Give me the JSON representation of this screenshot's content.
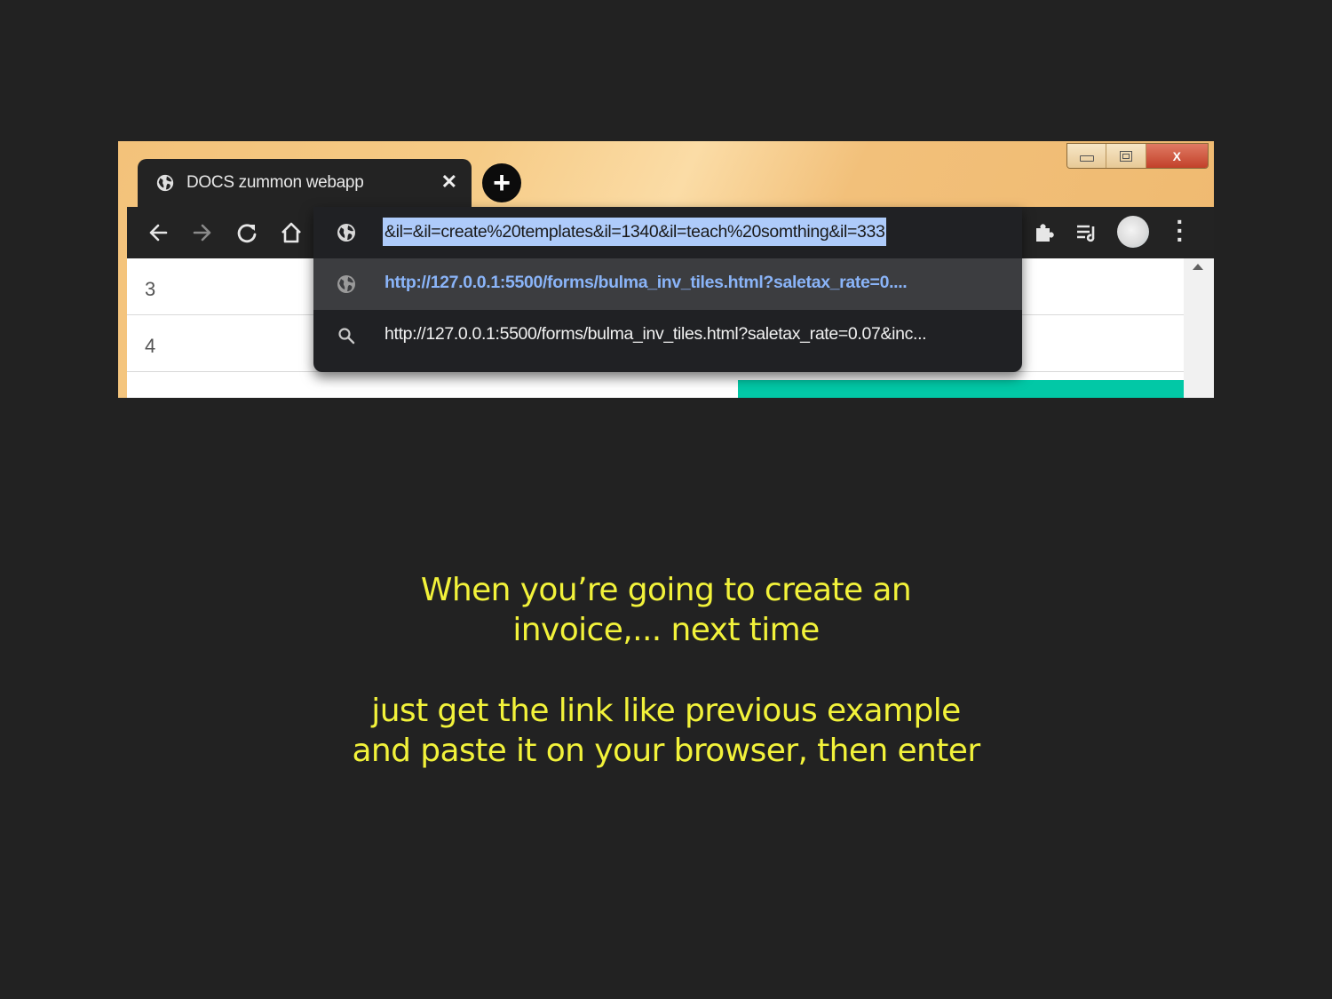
{
  "browser": {
    "tab": {
      "title": "DOCS zummon webapp",
      "close_glyph": "✕",
      "icon": "globe-icon"
    },
    "new_tab_glyph": "+",
    "window_controls": {
      "close_glyph": "X"
    },
    "address_bar": {
      "value": "&il=&il=create%20templates&il=1340&il=teach%20somthing&il=333",
      "highlight_color": "#aecbfa"
    },
    "suggestions": [
      {
        "icon": "globe-icon",
        "text": "http://127.0.0.1:5500/forms/bulma_inv_tiles.html?saletax_rate=0...."
      },
      {
        "icon": "search-icon",
        "text": "http://127.0.0.1:5500/forms/bulma_inv_tiles.html?saletax_rate=0.07&inc..."
      }
    ],
    "toolbar_icons": [
      "back-arrow-icon",
      "forward-arrow-icon",
      "reload-icon",
      "home-icon",
      "extensions-puzzle-icon",
      "media-queue-icon",
      "avatar",
      "kebab-menu-icon"
    ],
    "page": {
      "rows": [
        {
          "number": "3"
        },
        {
          "number": "4"
        }
      ],
      "accent_color": "#02c8a6"
    }
  },
  "caption": {
    "para1_line1": "When you’re going to create an",
    "para1_line2": "invoice,... next time",
    "para2_line1": "just get the link like previous example",
    "para2_line2": "and paste it on your browser, then enter",
    "color": "#f2f23a"
  }
}
